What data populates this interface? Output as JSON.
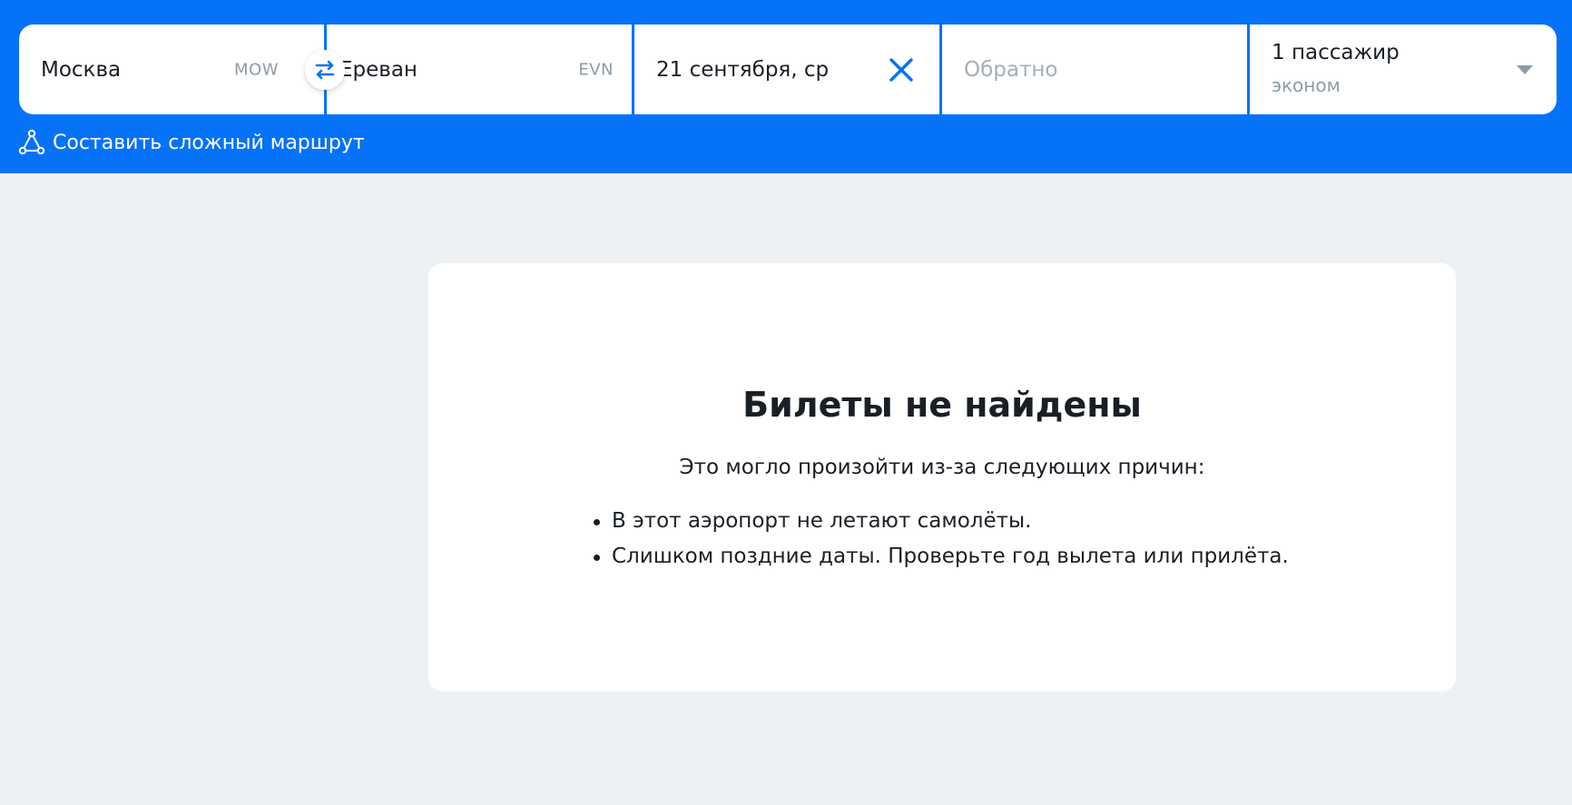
{
  "search": {
    "origin": {
      "city": "Москва",
      "iata": "MOW"
    },
    "destination": {
      "city": "Ереван",
      "iata": "EVN"
    },
    "depart_date": "21 сентября, ср",
    "return_placeholder": "Обратно",
    "passengers": {
      "count_label": "1 пассажир",
      "cabin_class": "эконом"
    }
  },
  "complex_route": {
    "label": "Составить сложный маршрут"
  },
  "result": {
    "title": "Билеты не найдены",
    "subtitle": "Это могло произойти из-за следующих причин:",
    "reasons": [
      "В этот аэропорт не летают самолёты.",
      "Слишком поздние даты. Проверьте год вылета или прилёта."
    ]
  },
  "colors": {
    "brand_blue": "#0672f8",
    "background": "#edf1f4",
    "muted_text": "#8d9ba6",
    "placeholder_text": "#a3afb8"
  },
  "icons": {
    "swap": "swap-arrows-icon",
    "clear": "close-icon",
    "dropdown": "caret-down-icon",
    "route": "route-triangle-icon"
  }
}
